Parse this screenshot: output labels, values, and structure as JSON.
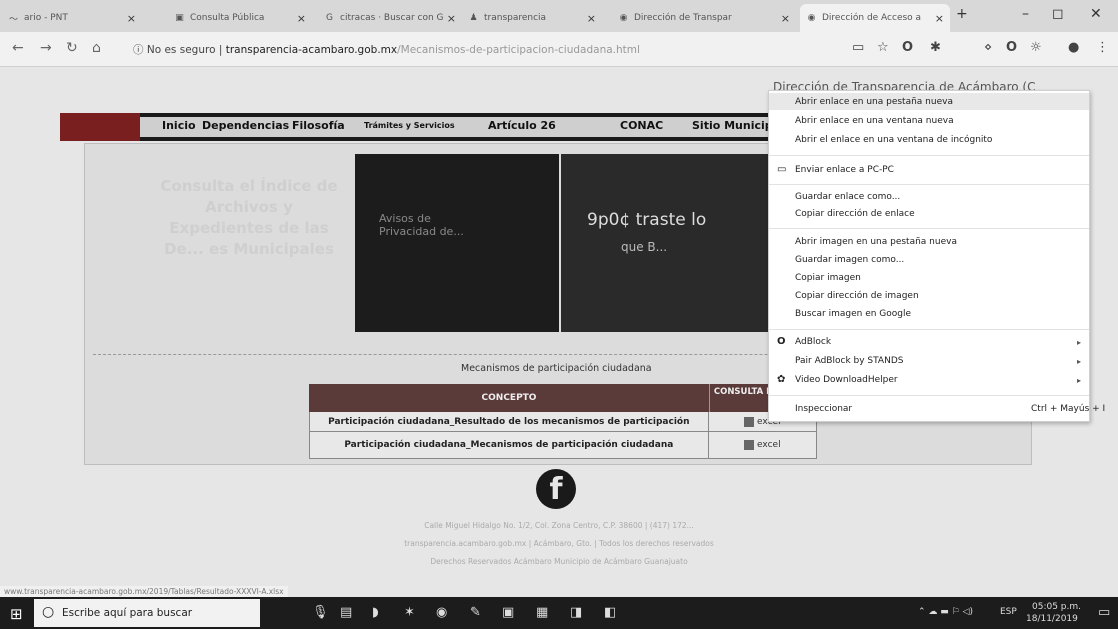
{
  "tabs": [
    {
      "label": "ario - PNT",
      "icon": "wave-icon"
    },
    {
      "label": "Consulta Pública",
      "icon": "document-icon"
    },
    {
      "label": "citracas · Buscar con G",
      "icon": "google-icon"
    },
    {
      "label": "transparencia",
      "icon": "person-icon"
    },
    {
      "label": "Dirección de Transpar",
      "icon": "globe-icon"
    },
    {
      "label": "Dirección de Acceso a",
      "icon": "globe-icon"
    }
  ],
  "address": {
    "security": "No es seguro",
    "host": "transparencia-acambaro.gob.mx",
    "path": "/Mecanismos-de-participacion-ciudadana.html"
  },
  "page": {
    "title_right": "Dirección de Transparencia de Acámbaro (C",
    "menu": [
      "Inicio",
      "Dependencias",
      "Filosofía",
      "Trámites y Servicios",
      "Artículo 26",
      "CONAC",
      "Sitio Municip"
    ],
    "left_banner": "Consulta el Índice de Archivos y Expedientes de las De... es Municipales",
    "slide1_text": "Avisos de Privacidad de...",
    "slide2_line1": "9p0¢ traste lo",
    "slide2_line2": "que B...",
    "section_title": "Mecanismos de participación ciudadana",
    "table": {
      "col1": "CONCEPTO",
      "col2": "CONSULTA FORMATO",
      "rows": [
        {
          "concept": "Participación ciudadana_Resultado de los mecanismos de participación",
          "format": "excel"
        },
        {
          "concept": "Participación ciudadana_Mecanismos de participación ciudadana",
          "format": "excel"
        }
      ]
    },
    "footer_lines": [
      "Calle Miguel Hidalgo No. 1/2, Col. Zona Centro, C.P. 38600 | (417) 172...",
      "transparencia.acambaro.gob.mx | Acámbaro, Gto. | Todos los derechos reservados",
      "Derechos Reservados Acámbaro Municipio de Acámbaro Guanajuato"
    ],
    "status_url": "www.transparencia-acambaro.gob.mx/2019/Tablas/Resultado-XXXVI-A.xlsx"
  },
  "context_menu": [
    {
      "label": "Abrir enlace en una pestaña nueva",
      "highlight": true
    },
    {
      "label": "Abrir enlace en una ventana nueva"
    },
    {
      "label": "Abrir el enlace en una ventana de incógnito"
    },
    {
      "label": "Enviar enlace a PC-PC",
      "icon": "send-icon"
    },
    {
      "label": "Guardar enlace como..."
    },
    {
      "label": "Copiar dirección de enlace"
    },
    {
      "label": "Abrir imagen en una pestaña nueva"
    },
    {
      "label": "Guardar imagen como..."
    },
    {
      "label": "Copiar imagen"
    },
    {
      "label": "Copiar dirección de imagen"
    },
    {
      "label": "Buscar imagen en Google"
    },
    {
      "label": "AdBlock",
      "icon": "adblock-icon",
      "arrow": true
    },
    {
      "label": "Pair AdBlock by STANDS",
      "arrow": true
    },
    {
      "label": "Video DownloadHelper",
      "icon": "downloadhelper-icon",
      "arrow": true
    },
    {
      "label": "Inspeccionar",
      "shortcut": "Ctrl + Mayús + I"
    }
  ],
  "taskbar": {
    "search_placeholder": "Escribe aquí para buscar",
    "lang": "ESP",
    "time": "05:05 p.m.",
    "date": "18/11/2019"
  }
}
